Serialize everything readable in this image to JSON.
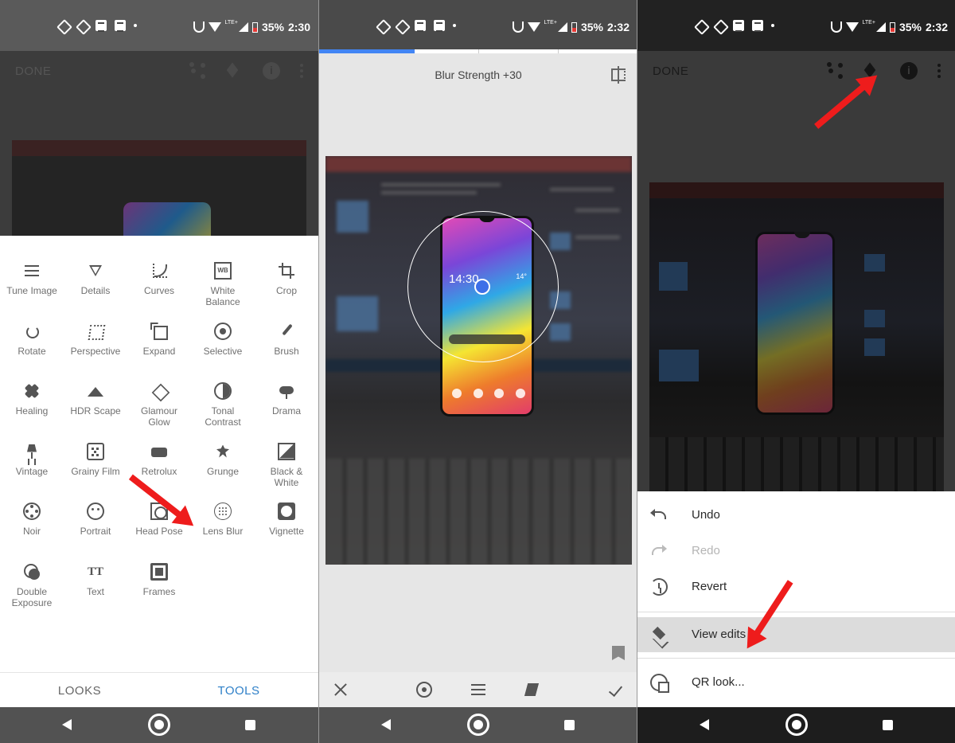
{
  "status_left": {
    "time": "2:30",
    "battery": "35%",
    "network": "LTE+"
  },
  "status_mid": {
    "time": "2:32",
    "battery": "35%",
    "network": "LTE+"
  },
  "status_right": {
    "time": "2:32",
    "battery": "35%",
    "network": "LTE+"
  },
  "panel1": {
    "done_label": "DONE",
    "tools": [
      {
        "label": "Tune Image",
        "icon": "tune-image-icon"
      },
      {
        "label": "Details",
        "icon": "details-icon"
      },
      {
        "label": "Curves",
        "icon": "curves-icon"
      },
      {
        "label": "White Balance",
        "icon": "white-balance-icon"
      },
      {
        "label": "Crop",
        "icon": "crop-icon"
      },
      {
        "label": "Rotate",
        "icon": "rotate-icon"
      },
      {
        "label": "Perspective",
        "icon": "perspective-icon"
      },
      {
        "label": "Expand",
        "icon": "expand-icon"
      },
      {
        "label": "Selective",
        "icon": "selective-icon"
      },
      {
        "label": "Brush",
        "icon": "brush-icon"
      },
      {
        "label": "Healing",
        "icon": "healing-icon"
      },
      {
        "label": "HDR Scape",
        "icon": "hdr-scape-icon"
      },
      {
        "label": "Glamour Glow",
        "icon": "glamour-glow-icon"
      },
      {
        "label": "Tonal Contrast",
        "icon": "tonal-contrast-icon"
      },
      {
        "label": "Drama",
        "icon": "drama-icon"
      },
      {
        "label": "Vintage",
        "icon": "vintage-icon"
      },
      {
        "label": "Grainy Film",
        "icon": "grainy-film-icon"
      },
      {
        "label": "Retrolux",
        "icon": "retrolux-icon"
      },
      {
        "label": "Grunge",
        "icon": "grunge-icon"
      },
      {
        "label": "Black & White",
        "icon": "black-white-icon"
      },
      {
        "label": "Noir",
        "icon": "noir-icon"
      },
      {
        "label": "Portrait",
        "icon": "portrait-icon"
      },
      {
        "label": "Head Pose",
        "icon": "head-pose-icon"
      },
      {
        "label": "Lens Blur",
        "icon": "lens-blur-icon"
      },
      {
        "label": "Vignette",
        "icon": "vignette-icon"
      },
      {
        "label": "Double Exposure",
        "icon": "double-exposure-icon"
      },
      {
        "label": "Text",
        "icon": "text-icon"
      },
      {
        "label": "Frames",
        "icon": "frames-icon"
      }
    ],
    "tabs": {
      "looks": "LOOKS",
      "tools": "TOOLS"
    },
    "colors": {
      "active_tab": "#2f80c8",
      "inactive_tab": "#666666"
    }
  },
  "panel2": {
    "blur_label": "Blur Strength +30",
    "progress": 0.3,
    "phone_clock": "14:30",
    "phone_temp": "14°",
    "accent": "#4285f4"
  },
  "panel3": {
    "done_label": "DONE",
    "menu": [
      {
        "label": "Undo",
        "icon": "undo-icon",
        "enabled": true
      },
      {
        "label": "Redo",
        "icon": "redo-icon",
        "enabled": false
      },
      {
        "label": "Revert",
        "icon": "revert-icon",
        "enabled": true
      },
      {
        "label": "View edits",
        "icon": "layers-icon",
        "enabled": true,
        "highlighted": true
      },
      {
        "label": "QR look...",
        "icon": "qr-look-icon",
        "enabled": true
      }
    ]
  }
}
